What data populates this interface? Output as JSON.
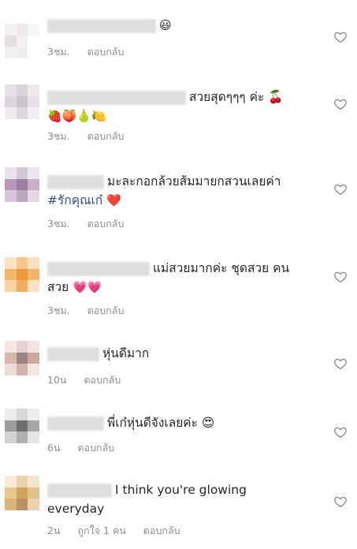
{
  "comments": [
    {
      "text": "😃",
      "emoji_text": "",
      "time": "3ชม.",
      "reply": "ตอบกลับ",
      "likes": "",
      "avatar_colors": [
        "#f2f2f2",
        "#efeaea",
        "#f6f6f6",
        "#e6dfdf",
        "#f5f0f0",
        "#ffffff",
        "#f2f2f2",
        "#f0eded",
        "#ffffff"
      ]
    },
    {
      "text": "สวยสุดๆๆๆ ค่ะ 🍒",
      "emoji_text": "🍓🍑🍐🍋",
      "time": "3ชม.",
      "reply": "ตอบกลับ",
      "likes": "",
      "avatar_colors": [
        "#e5e2e6",
        "#d9d4da",
        "#eceaea",
        "#dcd5dd",
        "#cdc4cf",
        "#e6e1e7",
        "#eeeaee",
        "#dcd6dd",
        "#f2eff2"
      ]
    },
    {
      "text": "มะละกอกล้วยส้มมายกสวนเลยค่า",
      "emoji_text": "❤️",
      "hashtag": "#รักคุณเก๋",
      "time": "3ชม.",
      "reply": "ตอบกลับ",
      "likes": "",
      "avatar_colors": [
        "#e8e2ea",
        "#d3c6d6",
        "#ece6ee",
        "#b59ab7",
        "#9c7fa0",
        "#c7b1ca",
        "#d6c7d8",
        "#bca6c0",
        "#e3d8e4"
      ]
    },
    {
      "text": "แม่สวยมากค่ะ ชุดสวย คน",
      "emoji_text": "💗💗",
      "line2": "สวย",
      "time": "3ชม.",
      "reply": "ตอบกลับ",
      "likes": "",
      "avatar_colors": [
        "#fbe3c6",
        "#f6c88f",
        "#fbe0bf",
        "#f3b569",
        "#ed9a3d",
        "#f4b468",
        "#f8d3a4",
        "#f1ad62",
        "#fbe2c2"
      ]
    },
    {
      "text": "หุ่นดีมาก",
      "emoji_text": "",
      "time": "10น",
      "reply": "ตอบกลับ",
      "likes": "",
      "avatar_colors": [
        "#f3e6e3",
        "#e9d0cb",
        "#f2e4e1",
        "#d9b6ad",
        "#9a8580",
        "#cfa79c",
        "#eddbd6",
        "#d4b3aa",
        "#f3e7e4"
      ]
    },
    {
      "text": "พี่เก๋หุ่นดีจังเลยค่ะ 😍",
      "emoji_text": "",
      "time": "6น",
      "reply": "ตอบกลับ",
      "likes": "",
      "avatar_colors": [
        "#ececec",
        "#d8d6d6",
        "#eeeeee",
        "#9e9c9c",
        "#6f6d6e",
        "#a7a5a5",
        "#d3d1d1",
        "#b1afaf",
        "#e6e5e5"
      ]
    },
    {
      "text": "I think you're glowing",
      "emoji_text": "",
      "line2": "everyday",
      "time": "2น",
      "likes": "ถูกใจ 1 คน",
      "reply": "ตอบกลับ",
      "avatar_colors": [
        "#f6ecd9",
        "#ead3a9",
        "#f4e6cc",
        "#e7c98d",
        "#cfa35e",
        "#e2c387",
        "#d9b57a",
        "#b89266",
        "#e9d3ad"
      ]
    }
  ],
  "heart_icon_color": "#8e8e8e"
}
